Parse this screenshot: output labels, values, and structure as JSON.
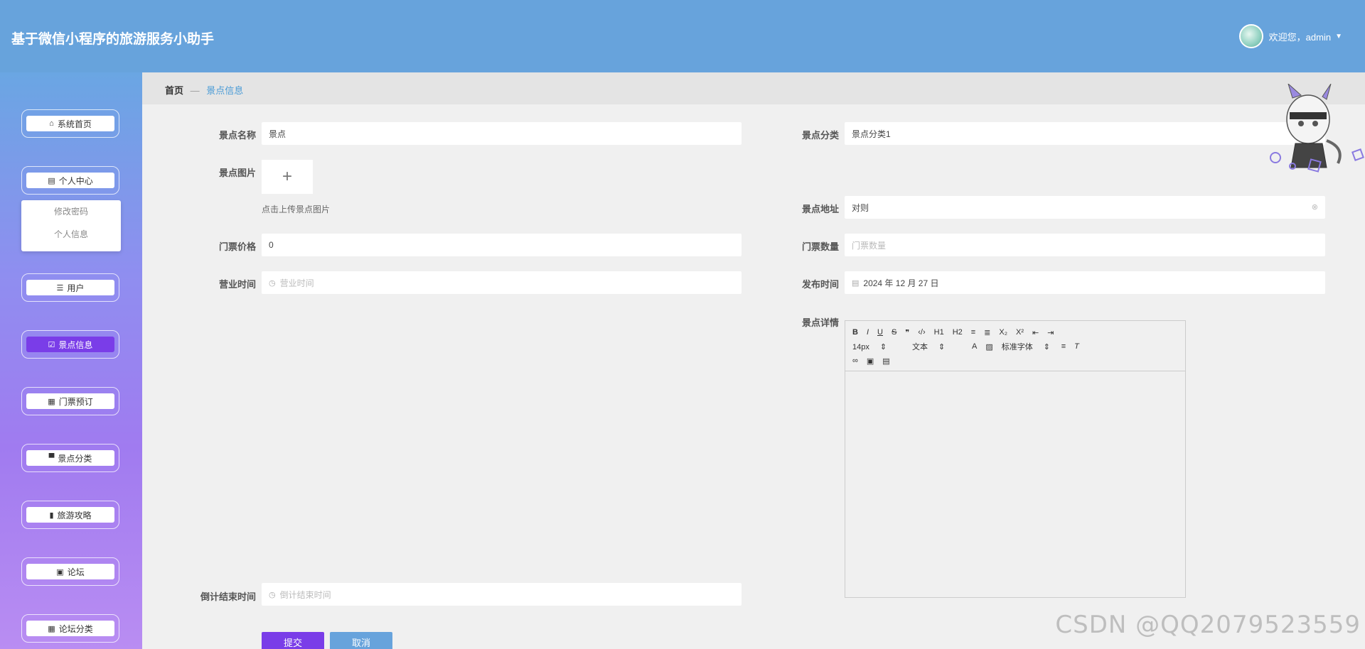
{
  "app": {
    "title": "基于微信小程序的旅游服务小助手"
  },
  "user": {
    "greeting": "欢迎您，admin"
  },
  "sidebar": {
    "items": [
      {
        "label": "系统首页",
        "icon": "home-icon"
      },
      {
        "label": "个人中心",
        "icon": "calendar-icon"
      },
      {
        "label": "用户",
        "icon": "sliders-icon"
      },
      {
        "label": "景点信息",
        "icon": "check-square-icon"
      },
      {
        "label": "门票预订",
        "icon": "grid-icon"
      },
      {
        "label": "景点分类",
        "icon": "monitor-icon"
      },
      {
        "label": "旅游攻略",
        "icon": "bar-chart-icon"
      },
      {
        "label": "论坛",
        "icon": "clipboard-icon"
      },
      {
        "label": "论坛分类",
        "icon": "grid-icon"
      }
    ],
    "submenu": [
      "修改密码",
      "个人信息"
    ],
    "active": "景点信息"
  },
  "breadcrumb": {
    "home": "首页",
    "separator": "—",
    "current": "景点信息"
  },
  "form": {
    "name": {
      "label": "景点名称",
      "value": "景点"
    },
    "category": {
      "label": "景点分类",
      "value": "景点分类1"
    },
    "image": {
      "label": "景点图片",
      "hint": "点击上传景点图片"
    },
    "address": {
      "label": "景点地址",
      "value": "对则"
    },
    "price": {
      "label": "门票价格",
      "value": "0"
    },
    "quantity": {
      "label": "门票数量",
      "placeholder": "门票数量"
    },
    "hours": {
      "label": "营业时间",
      "placeholder": "营业时间"
    },
    "publish_time": {
      "label": "发布时间",
      "value": "2024 年 12 月 27 日"
    },
    "detail": {
      "label": "景点详情"
    },
    "countdown": {
      "label": "倒计结束时间",
      "placeholder": "倒计结束时间"
    }
  },
  "editor": {
    "row1": [
      "B",
      "I",
      "U",
      "S",
      "❞",
      "‹/›",
      "H1",
      "H2",
      "≡",
      "≣",
      "X₂",
      "X²",
      "⇤",
      "⇥"
    ],
    "font_size": "14px",
    "text_type": "文本",
    "font_family": "标准字体"
  },
  "buttons": {
    "submit": "提交",
    "cancel": "取消"
  },
  "watermark": "CSDN @QQ2079523559"
}
